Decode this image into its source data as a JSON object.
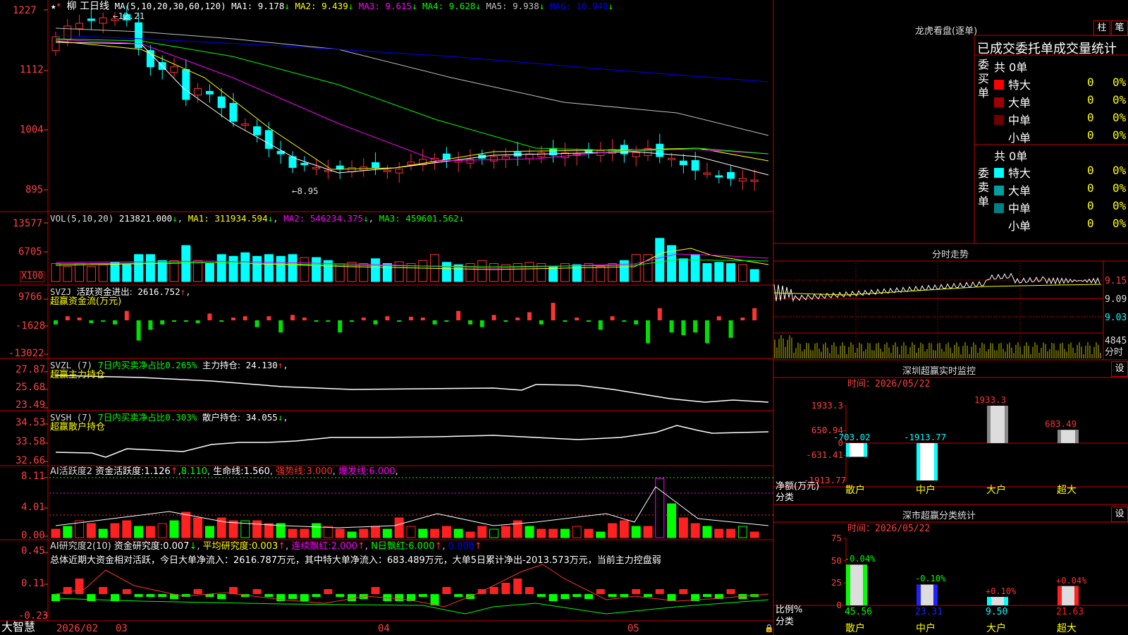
{
  "stock": {
    "name": "柳 工",
    "period": "日线",
    "star": "★",
    "mark": "*"
  },
  "main_header": {
    "ma_label": "MA(5,10,20,30,60,120)",
    "items": [
      {
        "label": "MA1:",
        "value": "9.178",
        "arrow": "↓",
        "color": "#ffffff"
      },
      {
        "label": "MA2:",
        "value": "9.439",
        "arrow": "↓",
        "color": "#ffff00"
      },
      {
        "label": "MA3:",
        "value": "9.615",
        "arrow": "↓",
        "color": "#ff00ff"
      },
      {
        "label": "MA4:",
        "value": "9.628",
        "arrow": "↓",
        "color": "#00ff00"
      },
      {
        "label": "MA5:",
        "value": "9.938",
        "arrow": "↓",
        "color": "#c0c0c0"
      },
      {
        "label": "MA6:",
        "value": "10.940",
        "arrow": "↓",
        "color": "#0000ff"
      }
    ]
  },
  "price_axis": [
    "1227",
    "1112",
    "1004",
    "895"
  ],
  "price_marks": {
    "high": "12.21",
    "low": "8.95"
  },
  "vol_header": {
    "label": "VOL(5,10,20)",
    "value": "213821.000",
    "ma1": "311934.594",
    "ma2": "546234.375",
    "ma3": "459601.562"
  },
  "vol_axis": [
    "13577",
    "6705",
    "X100"
  ],
  "svzj": {
    "label": "SVZJ",
    "text": "活跃资金进出:",
    "value": "2616.752",
    "sub": "超赢资金流(万元)",
    "axis": [
      "9766",
      "-1628",
      "-13022"
    ]
  },
  "svzl": {
    "label": "SVZL (7)",
    "text": "7日内买卖净占比",
    "pct": "0.265%",
    "hold": "主力持仓:",
    "value": "24.130",
    "sub": "超赢主力持仓",
    "axis": [
      "27.87",
      "25.68",
      "23.49"
    ]
  },
  "svsh": {
    "label": "SVSH (7)",
    "text": "7日内买卖净占比",
    "pct": "0.303%",
    "hold": "散户持仓:",
    "value": "34.055",
    "sub": "超赢散户持仓",
    "axis": [
      "34.53",
      "33.58",
      "32.66"
    ]
  },
  "ai1": {
    "label": "AI活跃度2",
    "t1": "资金活跃度:",
    "v1": "1.126",
    "v2": "8.110",
    "t3": "生命线:",
    "v3": "1.560",
    "t4": "强势线:",
    "v4": "3.000",
    "t5": "爆发线:",
    "v5": "6.000",
    "axis": [
      "8.11",
      "4.01",
      "0.00"
    ]
  },
  "ai2": {
    "label": "AI研究度2(10)",
    "t1": "资金研究度:",
    "v1": "0.007",
    "t2": "平均研究度:",
    "v2": "0.003",
    "t3": "连续飘红:",
    "v3": "2.000",
    "t4": "N日飘红:",
    "v4": "6.000",
    "v5": "0.008",
    "axis": [
      "0.45",
      "0.11",
      "-0.23"
    ],
    "summary": "总体近期大资金相对活跃，今日大单净流入：2616.787万元，其中特大单净流入：683.489万元，大单5日累计净出-2013.573万元，当前主力控盘弱"
  },
  "date_axis": {
    "brand": "大智慧",
    "labels": [
      "2026/02",
      "03",
      "04",
      "05"
    ]
  },
  "dragon": {
    "title": "龙虎看盘(逐单)",
    "btn1": "柱",
    "btn2": "笔",
    "heading": "已成交委托单成交量统计",
    "buy_label": "委买单",
    "sell_label": "委卖单",
    "buy_total": "共 0单",
    "sell_total": "共 0单",
    "buy_rows": [
      {
        "name": "特大",
        "count": "0",
        "pct": "0%",
        "color": "#ff0000"
      },
      {
        "name": "大单",
        "count": "0",
        "pct": "0%",
        "color": "#a00000"
      },
      {
        "name": "中单",
        "count": "0",
        "pct": "0%",
        "color": "#700000"
      },
      {
        "name": "小单",
        "count": "0",
        "pct": "0%",
        "color": ""
      }
    ],
    "sell_rows": [
      {
        "name": "特大",
        "count": "0",
        "pct": "0%",
        "color": "#00ffff"
      },
      {
        "name": "大单",
        "count": "0",
        "pct": "0%",
        "color": "#00a0a0"
      },
      {
        "name": "中单",
        "count": "0",
        "pct": "0%",
        "color": "#008080"
      },
      {
        "name": "小单",
        "count": "0",
        "pct": "0%",
        "color": ""
      }
    ]
  },
  "intraday": {
    "title": "分时走势",
    "axis": [
      "9.15",
      "9.09",
      "9.03"
    ],
    "vol_top": "4845",
    "vol_label": "分时"
  },
  "sz_monitor": {
    "title": "深圳超赢实时监控",
    "set": "设",
    "time_label": "时间：",
    "time": "2026/05/22",
    "axis": [
      "1933.3",
      "650.94",
      "0",
      "-631.41",
      "-1913.77"
    ],
    "ylabel": "净额(万元)",
    "xlabel": "分类"
  },
  "sz_class": {
    "title": "深市超赢分类统计",
    "set": "设",
    "time_label": "时间：",
    "time": "2026/05/22",
    "axis": [
      "75",
      "50",
      "25",
      "0"
    ],
    "ylabel": "比例%",
    "xlabel": "分类"
  },
  "chart_data": [
    {
      "type": "bar",
      "title": "深圳超赢实时监控",
      "categories": [
        "散户",
        "中户",
        "大户",
        "超大"
      ],
      "values": [
        -703.02,
        -1913.77,
        1933.3,
        683.49
      ],
      "ylabel": "净额(万元)",
      "xlabel": "分类",
      "ylim": [
        -1913.77,
        1933.3
      ]
    },
    {
      "type": "bar",
      "title": "深市超赢分类统计",
      "categories": [
        "散户",
        "中户",
        "大户",
        "超大"
      ],
      "values": [
        45.56,
        23.31,
        9.5,
        21.63
      ],
      "changes": [
        "-0.04%",
        "-0.10%",
        "+0.10%",
        "+0.04%"
      ],
      "ylabel": "比例%",
      "xlabel": "分类",
      "ylim": [
        0,
        75
      ]
    }
  ],
  "colors": {
    "up": "#ff3232",
    "down": "#00ffff",
    "frame": "#c80000",
    "text": "#dddddd",
    "yellow": "#ffff00"
  }
}
